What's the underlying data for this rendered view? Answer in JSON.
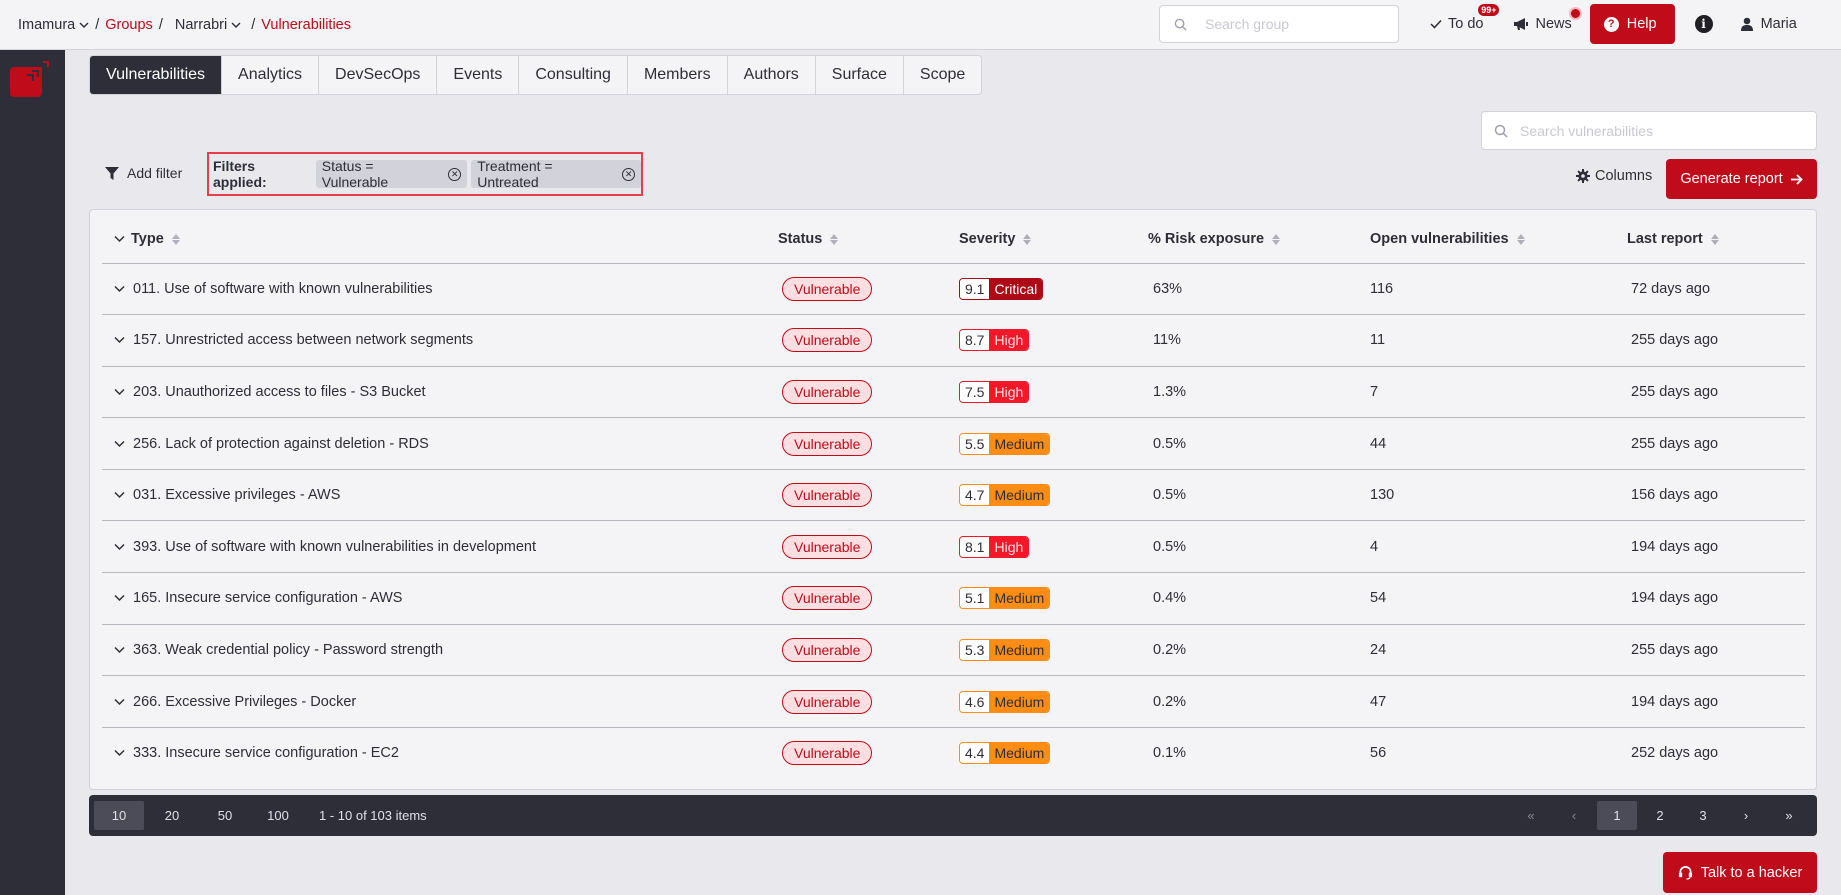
{
  "breadcrumb": {
    "organization": "Imamura",
    "groups_link": "Groups",
    "group": "Narrabri",
    "current": "Vulnerabilities",
    "separator": "/"
  },
  "topbar": {
    "search_placeholder": "Search group",
    "todo_label": "To do",
    "todo_badge": "99+",
    "news_label": "News",
    "help_label": "Help",
    "user_name": "Maria"
  },
  "tabs": [
    {
      "label": "Vulnerabilities",
      "active": true
    },
    {
      "label": "Analytics"
    },
    {
      "label": "DevSecOps"
    },
    {
      "label": "Events"
    },
    {
      "label": "Consulting"
    },
    {
      "label": "Members"
    },
    {
      "label": "Authors"
    },
    {
      "label": "Surface"
    },
    {
      "label": "Scope"
    }
  ],
  "toolbar": {
    "search_placeholder": "Search vulnerabilities",
    "add_filter_label": "Add filter",
    "filters_applied_label": "Filters applied:",
    "filters": [
      "Status = Vulnerable",
      "Treatment = Untreated"
    ],
    "columns_label": "Columns",
    "generate_report_label": "Generate report"
  },
  "table": {
    "headers": [
      "Type",
      "Status",
      "Severity",
      "% Risk exposure",
      "Open vulnerabilities",
      "Last report"
    ],
    "rows": [
      {
        "type": "011. Use of software with known vulnerabilities",
        "status": "Vulnerable",
        "score": "9.1",
        "level": "Critical",
        "risk": "63%",
        "open": "116",
        "last": "72 days ago"
      },
      {
        "type": "157. Unrestricted access between network segments",
        "status": "Vulnerable",
        "score": "8.7",
        "level": "High",
        "risk": "11%",
        "open": "11",
        "last": "255 days ago"
      },
      {
        "type": "203. Unauthorized access to files - S3 Bucket",
        "status": "Vulnerable",
        "score": "7.5",
        "level": "High",
        "risk": "1.3%",
        "open": "7",
        "last": "255 days ago"
      },
      {
        "type": "256. Lack of protection against deletion - RDS",
        "status": "Vulnerable",
        "score": "5.5",
        "level": "Medium",
        "risk": "0.5%",
        "open": "44",
        "last": "255 days ago"
      },
      {
        "type": "031. Excessive privileges - AWS",
        "status": "Vulnerable",
        "score": "4.7",
        "level": "Medium",
        "risk": "0.5%",
        "open": "130",
        "last": "156 days ago"
      },
      {
        "type": "393. Use of software with known vulnerabilities in development",
        "status": "Vulnerable",
        "score": "8.1",
        "level": "High",
        "risk": "0.5%",
        "open": "4",
        "last": "194 days ago"
      },
      {
        "type": "165. Insecure service configuration - AWS",
        "status": "Vulnerable",
        "score": "5.1",
        "level": "Medium",
        "risk": "0.4%",
        "open": "54",
        "last": "194 days ago"
      },
      {
        "type": "363. Weak credential policy - Password strength",
        "status": "Vulnerable",
        "score": "5.3",
        "level": "Medium",
        "risk": "0.2%",
        "open": "24",
        "last": "255 days ago"
      },
      {
        "type": "266. Excessive Privileges - Docker",
        "status": "Vulnerable",
        "score": "4.6",
        "level": "Medium",
        "risk": "0.2%",
        "open": "47",
        "last": "194 days ago"
      },
      {
        "type": "333. Insecure service configuration - EC2",
        "status": "Vulnerable",
        "score": "4.4",
        "level": "Medium",
        "risk": "0.1%",
        "open": "56",
        "last": "252 days ago"
      }
    ]
  },
  "pagination": {
    "page_sizes": [
      "10",
      "20",
      "50",
      "100"
    ],
    "selected_size": "10",
    "info": "1 - 10 of 103 items",
    "pages": [
      "1",
      "2",
      "3"
    ],
    "current_page": "1"
  },
  "talk_to_hacker_label": "Talk to a hacker",
  "colors": {
    "brand": "#bf0b1a",
    "dark": "#2e2e38",
    "critical": "#ac0a17",
    "high": "#f2182a",
    "medium": "#fb8c14"
  }
}
